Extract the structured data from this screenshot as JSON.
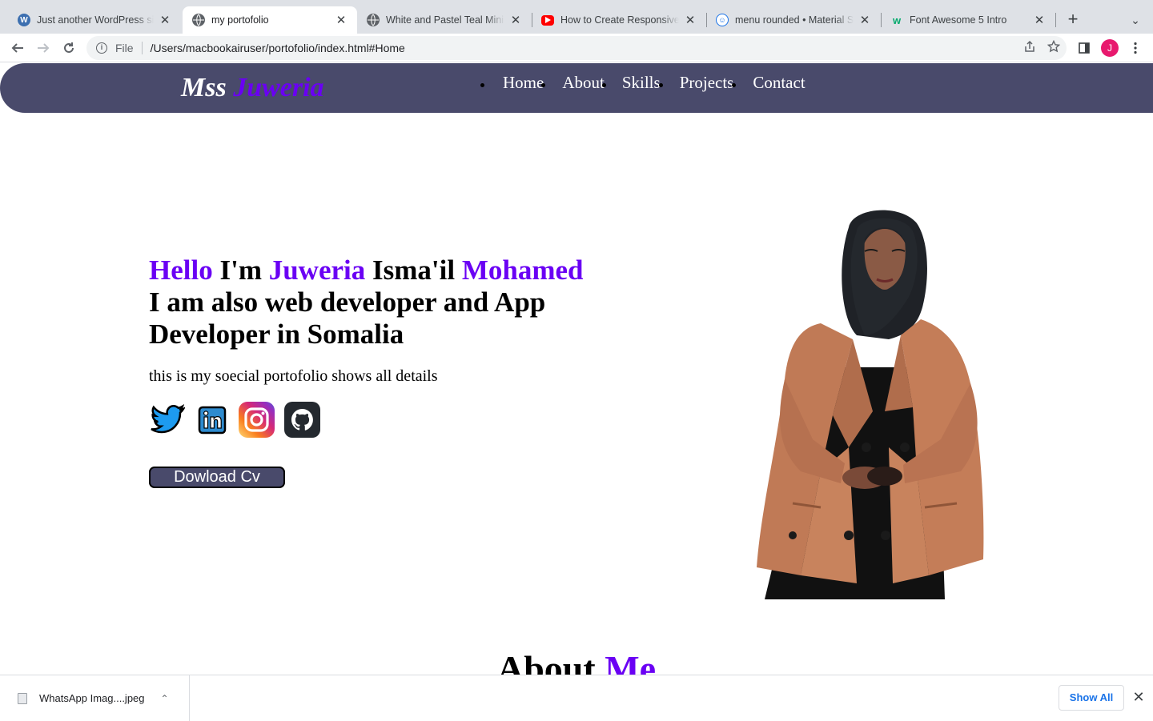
{
  "browser": {
    "tabs": [
      {
        "title": "Just another WordPress site",
        "favicon": "wordpress-icon",
        "active": false
      },
      {
        "title": "my portofolio",
        "favicon": "globe-icon",
        "active": true
      },
      {
        "title": "White and Pastel Teal Minimalist",
        "favicon": "globe-icon",
        "active": false
      },
      {
        "title": "How to Create Responsive",
        "favicon": "youtube-icon",
        "active": false
      },
      {
        "title": "menu rounded • Material Symbols",
        "favicon": "material-smile-icon",
        "active": false
      },
      {
        "title": "Font Awesome 5 Intro",
        "favicon": "w3schools-icon",
        "active": false
      }
    ],
    "new_tab_label": "+",
    "address": {
      "scheme_label": "File",
      "url": "/Users/macbookairuser/portofolio/index.html#Home"
    },
    "profile_initial": "J"
  },
  "site": {
    "logo": {
      "first": "Mss",
      "second": "Juweria"
    },
    "nav": [
      "Home",
      "About",
      "Skills",
      "Projects",
      "Contact"
    ],
    "hero": {
      "hello": "Hello",
      "im": "I'm",
      "first_name": "Juweria",
      "middle_name": "Isma'il",
      "last_name": "Mohamed",
      "line2": "I am also web developer and App Developer in Somalia",
      "subtitle": "this is my soecial portofolio shows all details",
      "cta": "Dowload Cv",
      "socials": [
        "twitter-icon",
        "linkedin-icon",
        "instagram-icon",
        "github-icon"
      ]
    },
    "about": {
      "first": "About",
      "second": "Me"
    }
  },
  "downloads": {
    "file_name": "WhatsApp Imag....jpeg",
    "show_all": "Show All"
  },
  "colors": {
    "nav_bg": "#494a6b",
    "accent": "#6a00f4",
    "profile": "#e8196e"
  }
}
